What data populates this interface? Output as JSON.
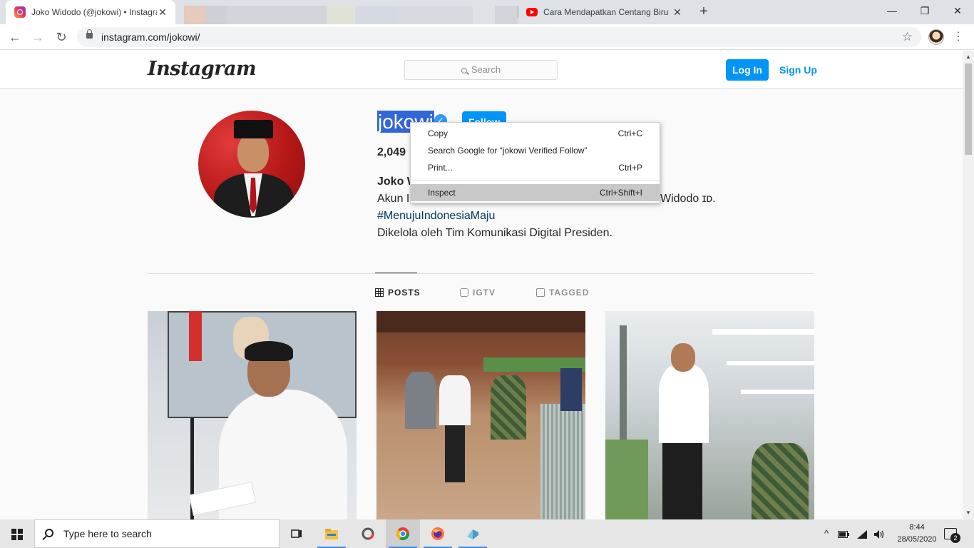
{
  "browser": {
    "tabs": [
      {
        "title": "Joko Widodo (@jokowi) • Instagram photos and videos",
        "close": "✕"
      },
      {
        "title": "Cara Mendapatkan Centang Biru",
        "close": "✕"
      }
    ],
    "new_tab": "+",
    "window_controls": {
      "minimize": "—",
      "maximize": "❐",
      "close": "✕"
    },
    "nav": {
      "back": "←",
      "forward": "→",
      "reload": "↻"
    },
    "url": "instagram.com/jokowi/",
    "star": "☆",
    "menu": "⋮"
  },
  "instagram": {
    "logo": "Instagram",
    "search_placeholder": "Search",
    "login_label": "Log In",
    "signup_label": "Sign Up",
    "profile": {
      "username_selected": "jokowi",
      "verified_mark": "✓",
      "follow_label": "Follow",
      "posts_count": "2,049",
      "full_name": "Joko W",
      "bio_line1_start": "Akun I",
      "bio_line1_end": "Widodo ɪᴅ.",
      "bio_hashtag": "#MenujuIndonesiaMaju",
      "bio_line3": "Dikelola oleh Tim Komunikasi Digital Presiden."
    },
    "tabs": [
      {
        "label": "POSTS"
      },
      {
        "label": "IGTV"
      },
      {
        "label": "TAGGED"
      }
    ]
  },
  "context_menu": {
    "items": [
      {
        "label": "Copy",
        "shortcut": "Ctrl+C"
      },
      {
        "label": "Search Google for “jokowi Verified Follow”",
        "shortcut": ""
      },
      {
        "label": "Print...",
        "shortcut": "Ctrl+P"
      },
      {
        "label": "Inspect",
        "shortcut": "Ctrl+Shift+I"
      }
    ]
  },
  "taskbar": {
    "search_placeholder": "Type here to search",
    "time": "8:44",
    "date": "28/05/2020",
    "notification_count": "2"
  },
  "colors": {
    "instagram_blue": "#0095f6",
    "selection": "#3367d6",
    "hashtag": "#00376b"
  }
}
